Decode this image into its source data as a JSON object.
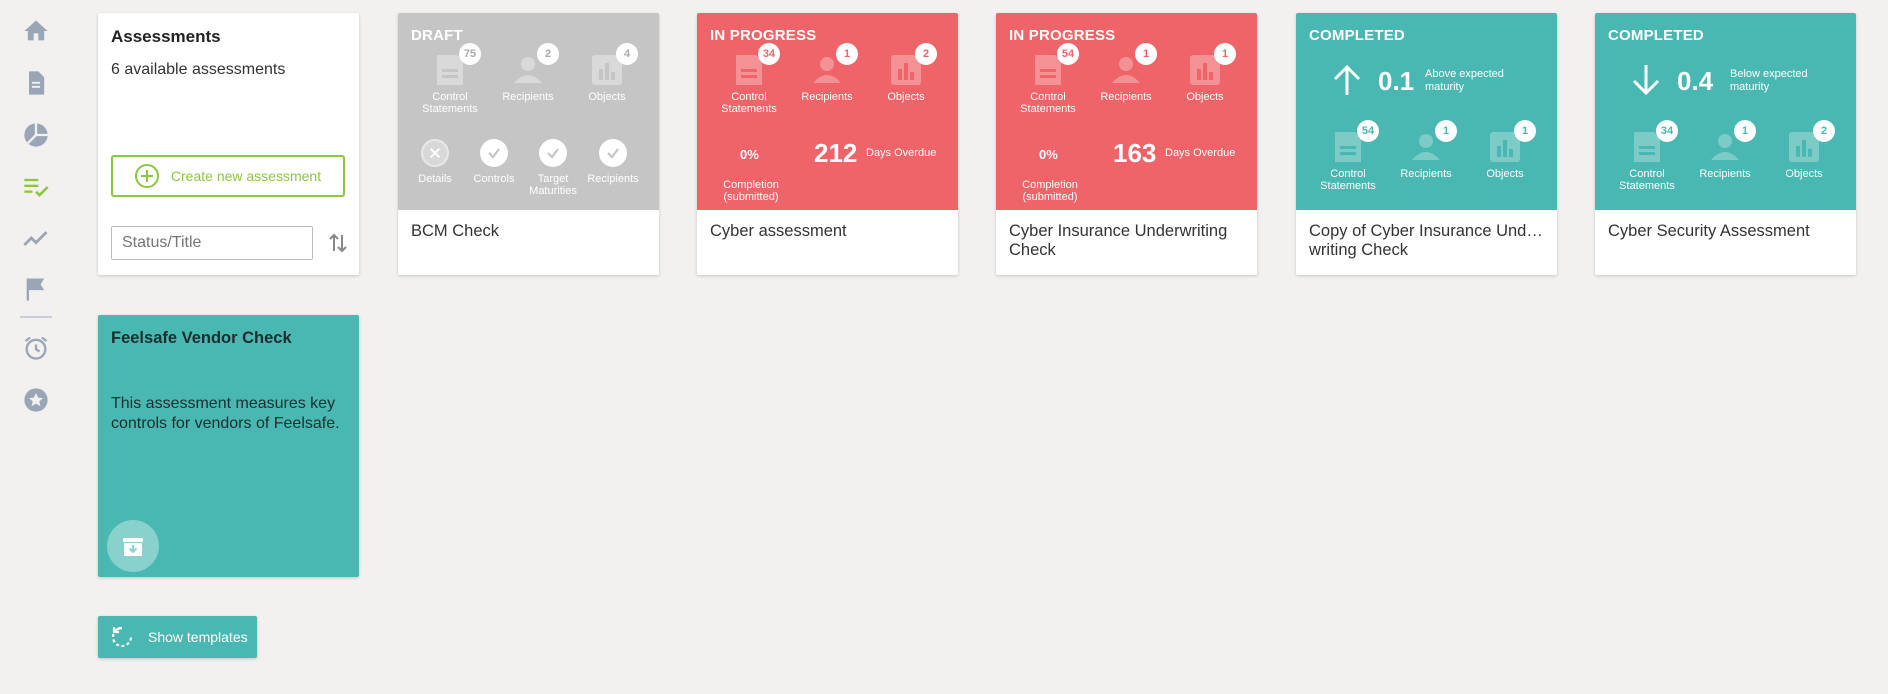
{
  "sidebar": {
    "items": [
      {
        "icon": "home-icon"
      },
      {
        "icon": "document-icon"
      },
      {
        "icon": "pie-chart-icon"
      },
      {
        "icon": "checklist-icon",
        "active": true
      },
      {
        "icon": "trend-icon"
      },
      {
        "icon": "flag-icon"
      },
      {
        "icon": "alarm-icon"
      },
      {
        "icon": "star-icon"
      }
    ],
    "active_color": "#8cc63f",
    "icon_color": "#9aa6b6"
  },
  "overview": {
    "title": "Assessments",
    "subtitle": "6 available assessments",
    "create_label": "Create new assessment",
    "search_placeholder": "Status/Title"
  },
  "colors": {
    "draft": "#c5c5c5",
    "in_progress": "#ee6468",
    "completed": "#49b8b2",
    "accent": "#8cc63f"
  },
  "cards": [
    {
      "status": "DRAFT",
      "title": "BCM Check",
      "stats": [
        {
          "label": "Control Statements",
          "count": "75"
        },
        {
          "label": "Recipients",
          "count": "2"
        },
        {
          "label": "Objects",
          "count": "4"
        }
      ],
      "steps": [
        {
          "label": "Details",
          "done": false
        },
        {
          "label": "Controls",
          "done": true
        },
        {
          "label": "Target Maturities",
          "done": true
        },
        {
          "label": "Recipients",
          "done": true
        }
      ]
    },
    {
      "status": "IN PROGRESS",
      "title": "Cyber assessment",
      "stats": [
        {
          "label": "Control Statements",
          "count": "34"
        },
        {
          "label": "Recipients",
          "count": "1"
        },
        {
          "label": "Objects",
          "count": "2"
        }
      ],
      "completion": "0%",
      "completion_label": "Completion (submitted)",
      "overdue": "212",
      "overdue_label": "Days Overdue"
    },
    {
      "status": "IN PROGRESS",
      "title": "Cyber Insurance Underwriting Check",
      "stats": [
        {
          "label": "Control Statements",
          "count": "54"
        },
        {
          "label": "Recipients",
          "count": "1"
        },
        {
          "label": "Objects",
          "count": "1"
        }
      ],
      "completion": "0%",
      "completion_label": "Completion (submitted)",
      "overdue": "163",
      "overdue_label": "Days Overdue"
    },
    {
      "status": "COMPLETED",
      "title": "Copy of Cyber Insurance Und… writing Check",
      "maturity": "0.1",
      "maturity_label": "Above expected maturity",
      "direction": "up",
      "stats": [
        {
          "label": "Control Statements",
          "count": "54"
        },
        {
          "label": "Recipients",
          "count": "1"
        },
        {
          "label": "Objects",
          "count": "1"
        }
      ]
    },
    {
      "status": "COMPLETED",
      "title": "Cyber Security Assessment",
      "maturity": "0.4",
      "maturity_label": "Below expected maturity",
      "direction": "down",
      "stats": [
        {
          "label": "Control Statements",
          "count": "34"
        },
        {
          "label": "Recipients",
          "count": "1"
        },
        {
          "label": "Objects",
          "count": "2"
        }
      ]
    }
  ],
  "template_card": {
    "title": "Feelsafe Vendor Check",
    "description": "This assessment measures key controls for vendors of Feelsafe."
  },
  "show_templates_label": "Show templates"
}
